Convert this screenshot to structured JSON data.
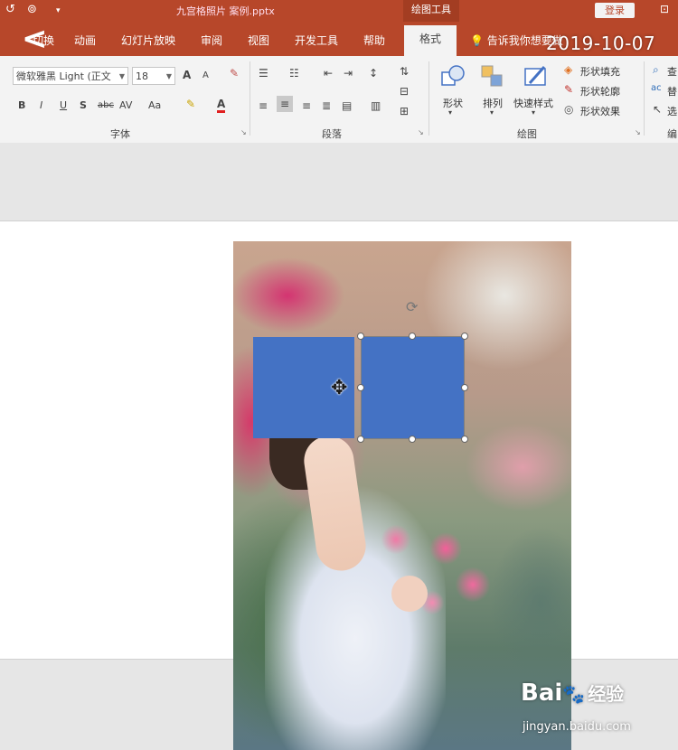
{
  "window": {
    "title": "九宫格照片 案例.pptx",
    "context_tab_group": "绘图工具",
    "login_label": "登录"
  },
  "overlay": {
    "timestamp": "2019-10-07"
  },
  "tabs": [
    {
      "label": "切换"
    },
    {
      "label": "动画"
    },
    {
      "label": "幻灯片放映"
    },
    {
      "label": "审阅"
    },
    {
      "label": "视图"
    },
    {
      "label": "开发工具"
    },
    {
      "label": "帮助"
    },
    {
      "label": "格式",
      "active": true
    }
  ],
  "tellme": "告诉我你想要做",
  "font_group": {
    "font_name": "微软雅黑 Light (正文",
    "font_size": "18",
    "label": "字体",
    "grow_font": "A",
    "shrink_font": "A",
    "bold": "B",
    "italic": "I",
    "underline": "U",
    "shadow": "S",
    "strike": "abc",
    "spacing": "AV",
    "case": "Aa",
    "font_color": "A"
  },
  "paragraph_group": {
    "label": "段落"
  },
  "drawing_group": {
    "label": "绘图",
    "shapes_label": "形状",
    "arrange_label": "排列",
    "quick_styles_label": "快速样式",
    "fill_label": "形状填充",
    "outline_label": "形状轮廓",
    "effects_label": "形状效果"
  },
  "editing_group": {
    "find_label": "查",
    "replace_label": "替",
    "select_label": "选",
    "label": "编"
  },
  "colors": {
    "ribbon_accent": "#b7472a",
    "shape_fill": "#4472c4"
  },
  "watermark": {
    "brand": "Bai",
    "brand_suffix": "经验",
    "url": "jingyan.baidu.com"
  }
}
